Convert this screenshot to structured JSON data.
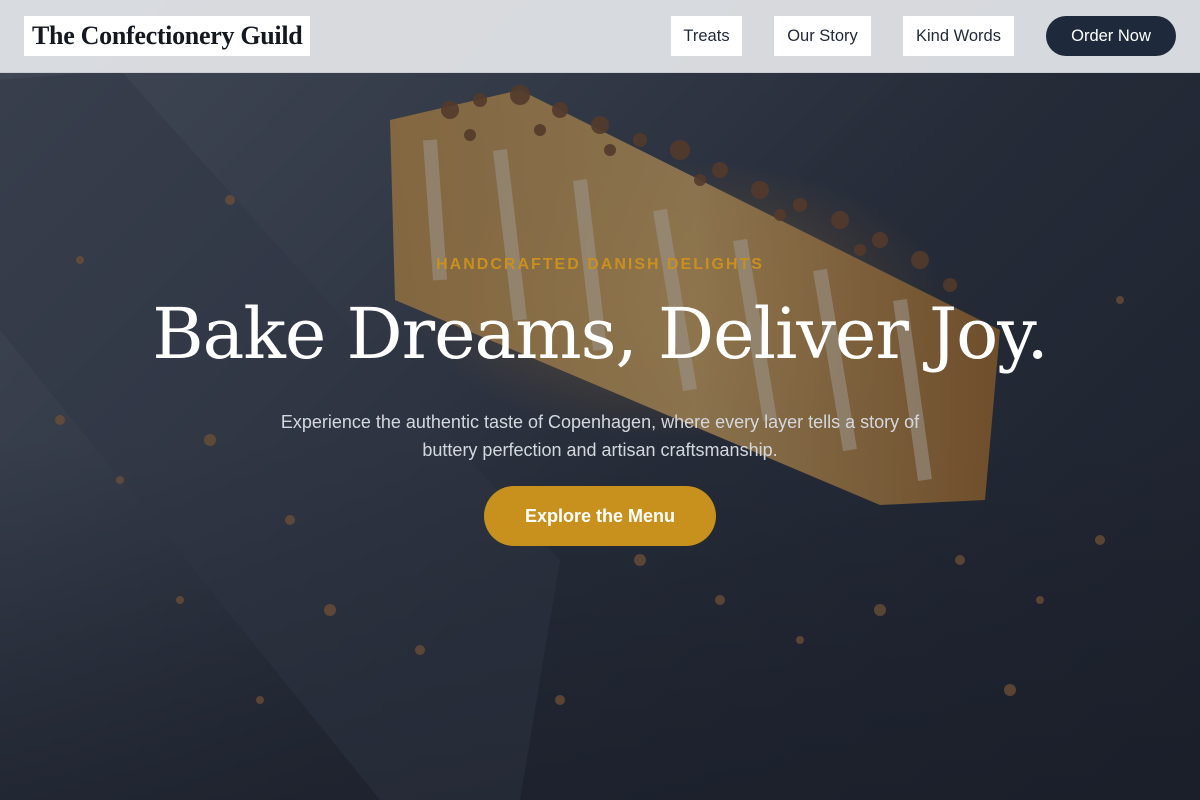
{
  "header": {
    "logo": "The Confectionery Guild",
    "nav": [
      "Treats",
      "Our Story",
      "Kind Words"
    ],
    "cta": "Order Now"
  },
  "hero": {
    "eyebrow": "HANDCRAFTED DANISH DELIGHTS",
    "title": "Bake Dreams, Deliver Joy.",
    "subtitle": "Experience the authentic taste of Copenhagen, where every layer tells a story of buttery perfection and artisan craftsmanship.",
    "button": "Explore the Menu",
    "background_image": "caramel-cheesecake-slice-with-chocolate-shavings"
  },
  "colors": {
    "accent_gold": "#c8901c",
    "navy": "#1e293b",
    "header_bg": "#e4e6e9"
  }
}
